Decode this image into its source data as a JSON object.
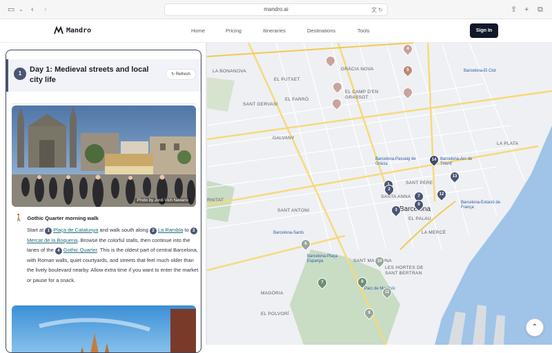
{
  "browser": {
    "url": "mandro.ai"
  },
  "nav": {
    "logo": "Mandro",
    "links": [
      "Home",
      "Pricing",
      "Itineraries",
      "Destinations",
      "Tools"
    ],
    "signin": "Sign In"
  },
  "itinerary": {
    "day_number": "1",
    "day_title": "Day 1: Medieval streets and local city life",
    "refresh_label": "Refresh",
    "photo_credit": "Photo by Jordi Vich Navarro",
    "section_title": "Gothic Quarter morning walk",
    "text": {
      "start_at": "Start at",
      "and_walk": "and walk south along",
      "to": "to",
      "browse": ". Browse the colorful stalls, then continue into the lanes of the",
      "rest": ". This is the oldest part of central Barcelona, with Roman walls, quiet courtyards, and streets that feel much older than the lively boulevard nearby. Allow extra time if you want to enter the market or pause for a snack."
    },
    "places": [
      {
        "num": "1",
        "name": "Plaça de Catalunya"
      },
      {
        "num": "2",
        "name": "La Rambla"
      },
      {
        "num": "3",
        "name": "Mercat de la Boqueria"
      },
      {
        "num": "4",
        "name": "Gothic Quarter"
      }
    ]
  },
  "map": {
    "city": "Barcelona",
    "districts": [
      "LA BONANOVA",
      "GRÀCIA NOVA",
      "EL PUTXET",
      "SANT GERVASI",
      "EL FARRÓ",
      "EL CAMP D'EN GRASSOT",
      "GALVANY",
      "LA PLATA",
      "SANT PERE",
      "SANTA ANNA",
      "EL PALAU",
      "LA MERCÈ",
      "SANT ANTONI",
      "SANT MADRONA",
      "LES HORTES DE SANT BERTRAN",
      "MAGÒRIA",
      "EL POLVORÍ",
      "RNITAT"
    ],
    "stations": [
      "Barcelona-El Clot",
      "Barcelona-Passeig de Gràcia",
      "Barcelona-Arc de Triomf",
      "Barcelona-Sants",
      "Barcelona-Estació de França",
      "Barcelona-Plaça Espanya",
      "Parc de Montjuïc"
    ],
    "markers": [
      "14",
      "13",
      "12",
      "7",
      "9",
      "1",
      "2",
      "3",
      "4",
      "5",
      "6",
      "7",
      "8",
      "9",
      "10",
      "11"
    ]
  },
  "colors": {
    "accent": "#4b5574",
    "signin_bg": "#111827",
    "link": "#1d6b7a",
    "water": "#9fc4e8",
    "park": "#c9dcc4",
    "road": "#f7d97a"
  },
  "icons": [
    "sidebar-icon",
    "back-icon",
    "forward-icon",
    "translate-icon",
    "reload-icon",
    "share-icon",
    "new-tab-icon",
    "tabs-icon",
    "refresh-icon",
    "walking-icon",
    "chevron-up-icon"
  ]
}
